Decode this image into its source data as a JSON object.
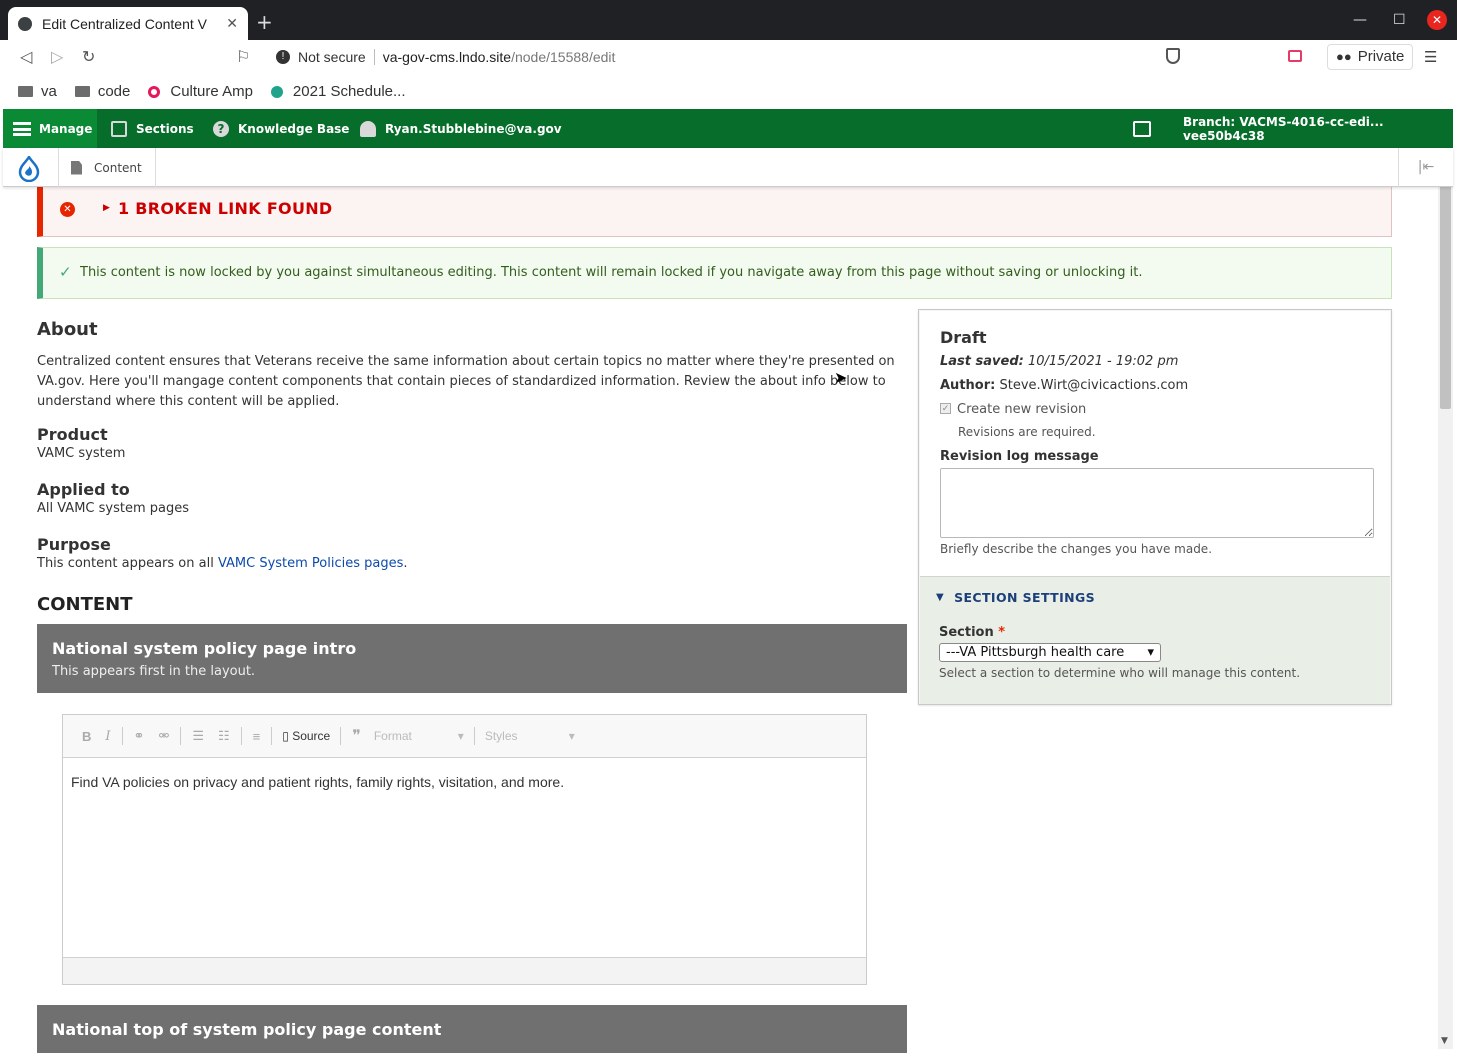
{
  "browser": {
    "tab_title": "Edit Centralized Content V",
    "new_tab": "+",
    "security_label": "Not secure",
    "url_host": "va-gov-cms.lndo.site",
    "url_path": "/node/15588/edit",
    "private_label": "Private",
    "bookmarks": [
      {
        "label": "va",
        "icon": "folder-icon"
      },
      {
        "label": "code",
        "icon": "folder-icon"
      },
      {
        "label": "Culture Amp",
        "icon": "cultureamp-icon",
        "color": "#e4185a"
      },
      {
        "label": "2021 Schedule...",
        "icon": "schedule-icon",
        "color": "#1fa38a"
      }
    ]
  },
  "toolbar": {
    "manage": "Manage",
    "sections": "Sections",
    "knowledge_base": "Knowledge Base",
    "user": "Ryan.Stubblebine@va.gov",
    "branch": "Branch: VACMS-4016-cc-edi... vee50b4c38",
    "accent": "#076d2a"
  },
  "subbar": {
    "content": "Content"
  },
  "messages": {
    "error": "1 BROKEN LINK FOUND",
    "status": "This content is now locked by you against simultaneous editing. This content will remain locked if you navigate away from this page without saving or unlocking it."
  },
  "about": {
    "heading": "About",
    "text": "Centralized content ensures that Veterans receive the same information about certain topics no matter where they're presented on VA.gov. Here you'll mangage content components that contain pieces of standardized information. Review the about info below to understand where this content will be applied.",
    "product_label": "Product",
    "product_value": "VAMC system",
    "applied_label": "Applied to",
    "applied_value": "All VAMC system pages",
    "purpose_label": "Purpose",
    "purpose_prefix": "This content appears on all ",
    "purpose_link": "VAMC System Policies pages",
    "purpose_suffix": "."
  },
  "content": {
    "heading": "CONTENT",
    "paragraphs": [
      {
        "title": "National system policy page intro",
        "description": "This appears first in the layout."
      },
      {
        "title": "National top of system policy page content",
        "description": ""
      }
    ],
    "editor": {
      "source_label": "Source",
      "format_placeholder": "Format",
      "styles_placeholder": "Styles",
      "body": "Find VA policies on privacy and patient rights, family rights, visitation, and more."
    }
  },
  "sidebar": {
    "status": "Draft",
    "last_saved_label": "Last saved:",
    "last_saved_value": "10/15/2021 - 19:02 pm",
    "author_label": "Author:",
    "author_value": "Steve.Wirt@civicactions.com",
    "create_revision": "Create new revision",
    "revisions_required": "Revisions are required.",
    "log_label": "Revision log message",
    "log_value": "",
    "log_description": "Briefly describe the changes you have made.",
    "section_settings": "SECTION SETTINGS",
    "section_label": "Section",
    "section_value": "---VA Pittsburgh health care",
    "section_description": "Select a section to determine who will manage this content."
  }
}
